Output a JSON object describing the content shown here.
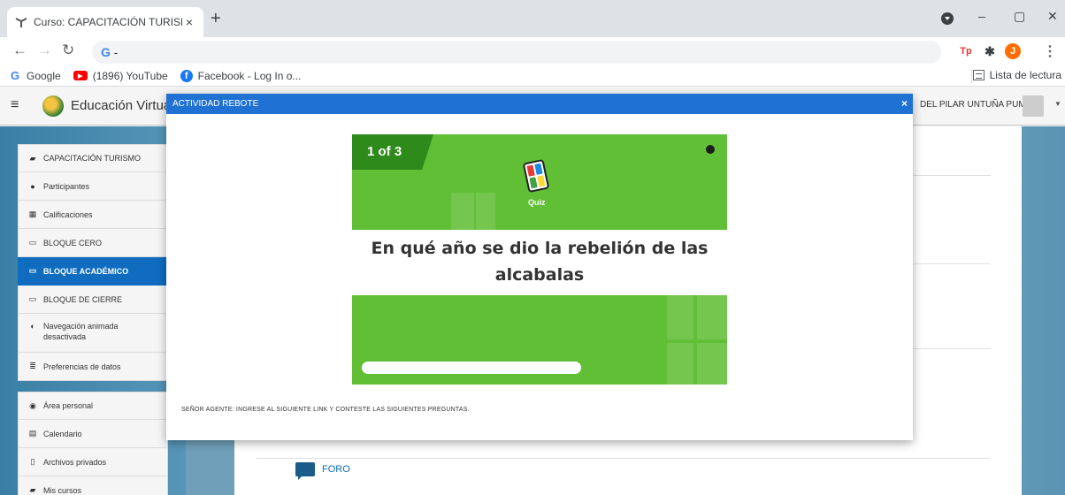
{
  "browser": {
    "tab_title": "Curso: CAPACITACIÓN TURISMO",
    "tab_close": "×",
    "new_tab": "+",
    "address_text": "-",
    "window_controls": {
      "profile": "",
      "minimize": "–",
      "restore": "▢",
      "close": "✕"
    },
    "extensions": {
      "tp": "Tp",
      "puzzle": "✱",
      "avatar": "J",
      "menu": "⋮"
    },
    "bookmarks": [
      {
        "label": "Google",
        "icon": "google-icon"
      },
      {
        "label": "(1896) YouTube",
        "icon": "youtube-icon"
      },
      {
        "label": "Facebook - Log In o...",
        "icon": "facebook-icon"
      }
    ],
    "reading_list": "Lista de lectura"
  },
  "moodle": {
    "site_name": "Educación Virtual",
    "user_name": "DEL PILAR UNTUÑA PUMA",
    "drawer": [
      {
        "label": "CAPACITACIÓN TURISMO",
        "icon": "graduation-cap-icon"
      },
      {
        "label": "Participantes",
        "icon": "users-icon"
      },
      {
        "label": "Calificaciones",
        "icon": "table-icon"
      },
      {
        "label": "BLOQUE CERO",
        "icon": "folder-icon"
      },
      {
        "label": "BLOQUE ACADÉMICO",
        "icon": "folder-icon",
        "active": true
      },
      {
        "label": "BLOQUE DE CIERRE",
        "icon": "folder-icon"
      },
      {
        "label": "Navegación animada desactivada",
        "icon": "toggle-icon"
      },
      {
        "label": "Preferencias de datos",
        "icon": "database-icon"
      },
      {
        "label": "Área personal",
        "icon": "dashboard-icon"
      },
      {
        "label": "Calendario",
        "icon": "calendar-icon"
      },
      {
        "label": "Archivos privados",
        "icon": "file-icon"
      },
      {
        "label": "Mis cursos",
        "icon": "graduation-cap-icon"
      }
    ],
    "foro_label": "FORO"
  },
  "modal": {
    "title": "ACTIVIDAD REBOTE",
    "close": "×",
    "counter": "1 of 3",
    "quiz_label": "Quiz",
    "question": "En qué año se dio la rebelión de las alcabalas",
    "footer": "SEÑOR AGENTE: INGRESE AL SIGUIENTE LINK Y CONTESTE LAS SIGUIENTES PREGUNTAS.",
    "colors": {
      "header": "#1f72d3",
      "quiz_green": "#61bf36",
      "counter_green": "#2f8a1c"
    }
  }
}
